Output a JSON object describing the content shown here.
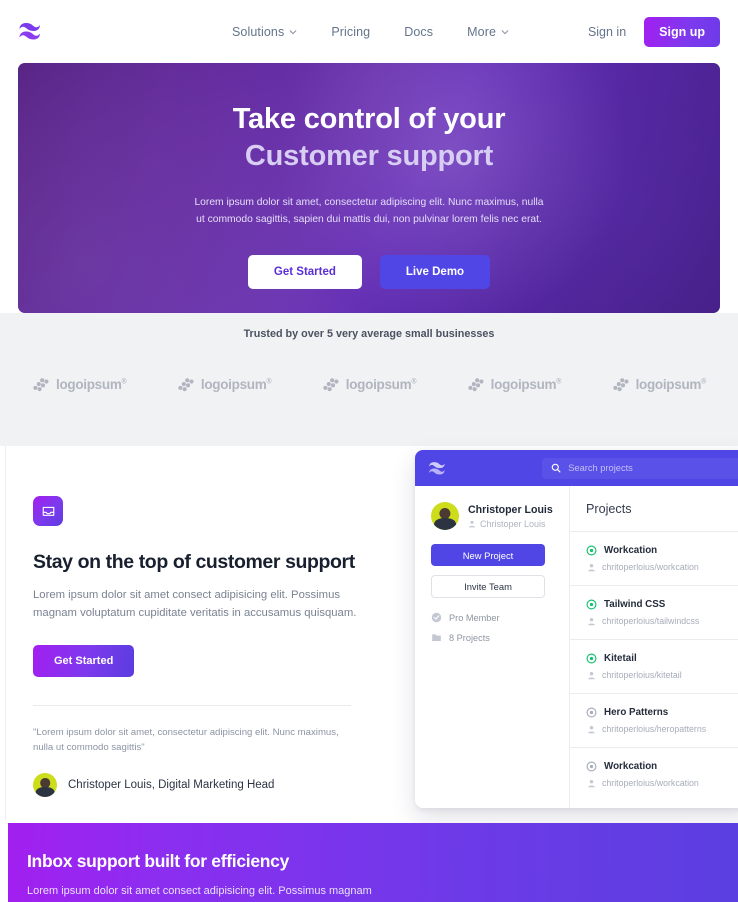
{
  "nav": {
    "logo_icon": "wave-logo-icon",
    "links": [
      {
        "label": "Solutions",
        "has_caret": true
      },
      {
        "label": "Pricing",
        "has_caret": false
      },
      {
        "label": "Docs",
        "has_caret": false
      },
      {
        "label": "More",
        "has_caret": true
      }
    ],
    "signin_label": "Sign in",
    "signup_label": "Sign up"
  },
  "hero": {
    "title_line1": "Take control of your",
    "title_line2": "Customer support",
    "paragraph": "Lorem ipsum dolor sit amet, consectetur adipiscing elit. Nunc maximus, nulla ut commodo sagittis, sapien dui mattis dui, non pulvinar lorem felis nec erat.",
    "primary_button": "Get Started",
    "secondary_button": "Live Demo"
  },
  "trust": {
    "headline": "Trusted by over 5 very average small businesses",
    "logos": [
      {
        "name": "logoipsum",
        "mark": "logoipsum-mark-icon"
      },
      {
        "name": "logoipsum",
        "mark": "logoipsum-mark-icon"
      },
      {
        "name": "logoipsum",
        "mark": "logoipsum-mark-icon"
      },
      {
        "name": "logoipsum",
        "mark": "logoipsum-mark-icon"
      },
      {
        "name": "logoipsum",
        "mark": "logoipsum-mark-icon"
      }
    ]
  },
  "feature": {
    "badge_icon": "inbox-icon",
    "heading": "Stay on the top of customer support",
    "lead": "Lorem ipsum dolor sit amet consect adipisicing elit. Possimus magnam voluptatum cupiditate veritatis in accusamus quisquam.",
    "cta_label": "Get Started",
    "quote": "\"Lorem ipsum dolor sit amet, consectetur adipiscing elit. Nunc maximus, nulla ut commodo sagittis\"",
    "attribution": "Christoper Louis, Digital Marketing Head"
  },
  "app": {
    "logo_icon": "wave-logo-icon",
    "search_icon": "search-icon",
    "search_placeholder": "Search projects",
    "user": {
      "name": "Christoper Louis",
      "handle": "Christoper Louis",
      "handle_icon": "user-icon"
    },
    "new_project_label": "New Project",
    "invite_team_label": "Invite Team",
    "meta": [
      {
        "label": "Pro Member",
        "icon": "check-circle-icon"
      },
      {
        "label": "8 Projects",
        "icon": "folder-icon"
      }
    ],
    "projects_heading": "Projects",
    "projects": [
      {
        "name": "Workcation",
        "path": "chritoperloius/workcation",
        "status_color": "#16c172",
        "status_icon": "target-icon",
        "path_icon": "user-icon"
      },
      {
        "name": "Tailwind CSS",
        "path": "chritoperloius/tailwindcss",
        "status_color": "#16c172",
        "status_icon": "target-icon",
        "path_icon": "user-icon"
      },
      {
        "name": "Kitetail",
        "path": "chritoperloius/kitetail",
        "status_color": "#16c172",
        "status_icon": "target-icon",
        "path_icon": "user-icon"
      },
      {
        "name": "Hero Patterns",
        "path": "chritoperloius/heropatterns",
        "status_color": "#a7adb9",
        "status_icon": "target-icon",
        "path_icon": "user-icon"
      },
      {
        "name": "Workcation",
        "path": "chritoperloius/workcation",
        "status_color": "#a7adb9",
        "status_icon": "target-icon",
        "path_icon": "user-icon"
      }
    ]
  },
  "bottom": {
    "heading": "Inbox support built for efficiency",
    "paragraph": "Lorem ipsum dolor sit amet consect adipisicing elit. Possimus magnam"
  },
  "colors": {
    "brand_violet": "#4f46e5",
    "brand_purple": "#a21ff0",
    "band_gray": "#f1f2f4",
    "status_green": "#16c172"
  }
}
